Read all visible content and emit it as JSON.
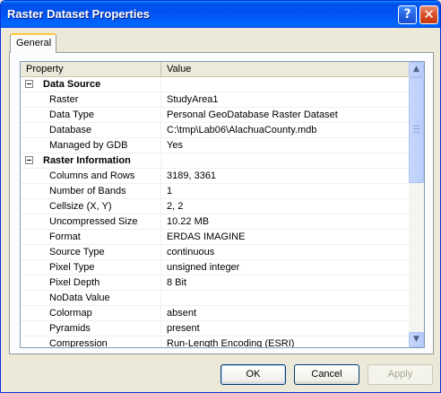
{
  "window": {
    "title": "Raster Dataset Properties",
    "help_glyph": "?",
    "close_glyph": "✕"
  },
  "tabs": [
    {
      "label": "General",
      "selected": true
    }
  ],
  "grid": {
    "columns": {
      "property": "Property",
      "value": "Value"
    },
    "rows": [
      {
        "type": "group",
        "property": "Data Source",
        "value": ""
      },
      {
        "type": "item",
        "property": "Raster",
        "value": "StudyArea1"
      },
      {
        "type": "item",
        "property": "Data Type",
        "value": "Personal GeoDatabase Raster Dataset"
      },
      {
        "type": "item",
        "property": "Database",
        "value": "C:\\tmp\\Lab06\\AlachuaCounty.mdb"
      },
      {
        "type": "item",
        "property": "Managed by GDB",
        "value": "Yes"
      },
      {
        "type": "group",
        "property": "Raster Information",
        "value": ""
      },
      {
        "type": "item",
        "property": "Columns and Rows",
        "value": "3189, 3361"
      },
      {
        "type": "item",
        "property": "Number of Bands",
        "value": "1"
      },
      {
        "type": "item",
        "property": "Cellsize (X, Y)",
        "value": "2, 2"
      },
      {
        "type": "item",
        "property": "Uncompressed Size",
        "value": "10.22 MB"
      },
      {
        "type": "item",
        "property": "Format",
        "value": "ERDAS IMAGINE"
      },
      {
        "type": "item",
        "property": "Source Type",
        "value": "continuous"
      },
      {
        "type": "item",
        "property": "Pixel Type",
        "value": "unsigned integer"
      },
      {
        "type": "item",
        "property": "Pixel Depth",
        "value": "8 Bit"
      },
      {
        "type": "item",
        "property": "NoData Value",
        "value": ""
      },
      {
        "type": "item",
        "property": "Colormap",
        "value": "absent"
      },
      {
        "type": "item",
        "property": "Pyramids",
        "value": "present"
      },
      {
        "type": "item",
        "property": "Compression",
        "value": "Run-Length Encoding (ESRI)"
      }
    ]
  },
  "scrollbar": {
    "up_glyph": "▲",
    "down_glyph": "▼"
  },
  "buttons": {
    "ok": "OK",
    "cancel": "Cancel",
    "apply": "Apply"
  }
}
